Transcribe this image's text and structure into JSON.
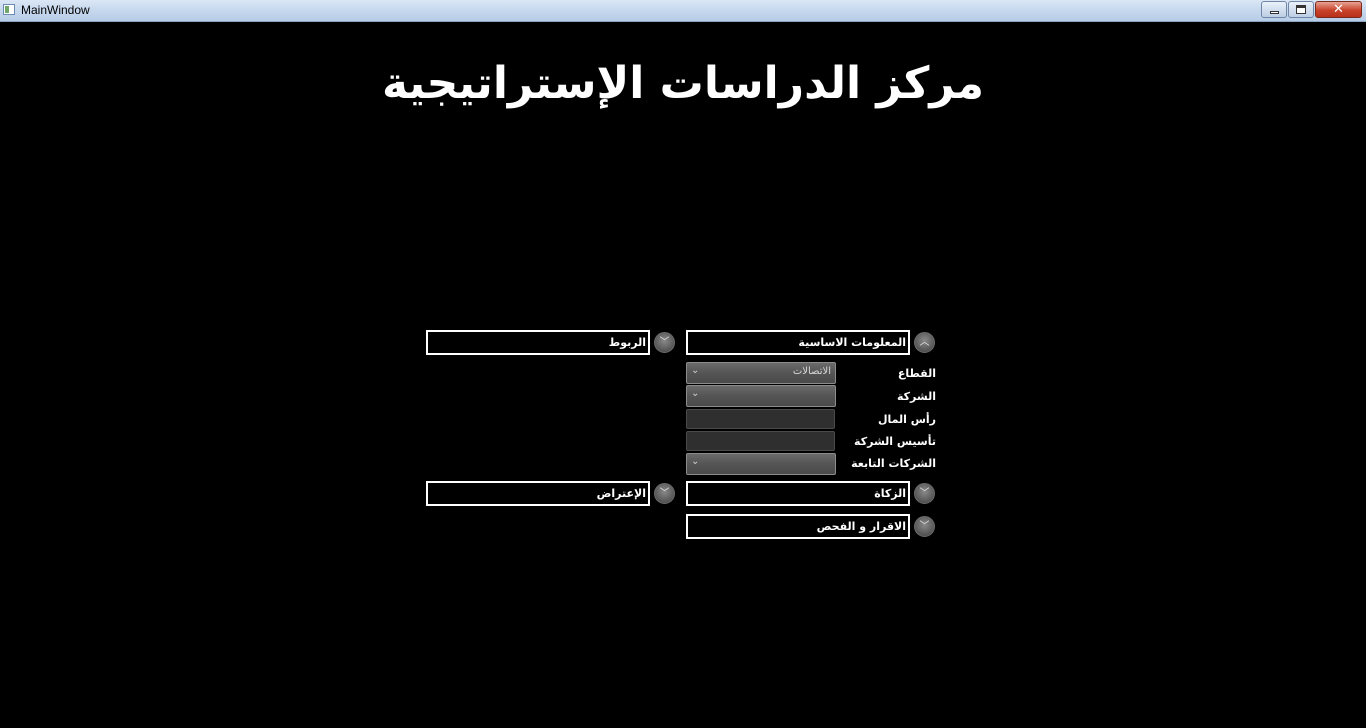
{
  "window": {
    "title": "MainWindow"
  },
  "heading": "مركز الدراسات الإستراتيجية",
  "right_column": {
    "basic_info": {
      "label": "المعلومات الاساسية",
      "expanded": true,
      "toggle_icon": "chevron-up-icon",
      "fields": {
        "sector_label": "القطاع",
        "sector_value": "الاتصالات",
        "company_label": "الشركة",
        "company_value": "",
        "capital_label": "رأس المال",
        "capital_value": "",
        "founding_label": "تأسيس الشركة",
        "founding_value": "",
        "subsidiaries_label": "الشركات التابعة",
        "subsidiaries_value": ""
      }
    },
    "zakat": {
      "label": "الزكاة",
      "expanded": false,
      "toggle_icon": "chevron-down-icon"
    },
    "declaration": {
      "label": "الاقرار و الفحص",
      "expanded": false,
      "toggle_icon": "chevron-down-icon"
    }
  },
  "left_column": {
    "links": {
      "label": "الربوط",
      "expanded": false,
      "toggle_icon": "chevron-down-icon"
    },
    "objection": {
      "label": "الإعتراض",
      "expanded": false,
      "toggle_icon": "chevron-down-icon"
    }
  },
  "colors": {
    "background": "#000000",
    "text": "#ffffff",
    "combo": "#555555",
    "textbox": "#2f2f2f"
  }
}
